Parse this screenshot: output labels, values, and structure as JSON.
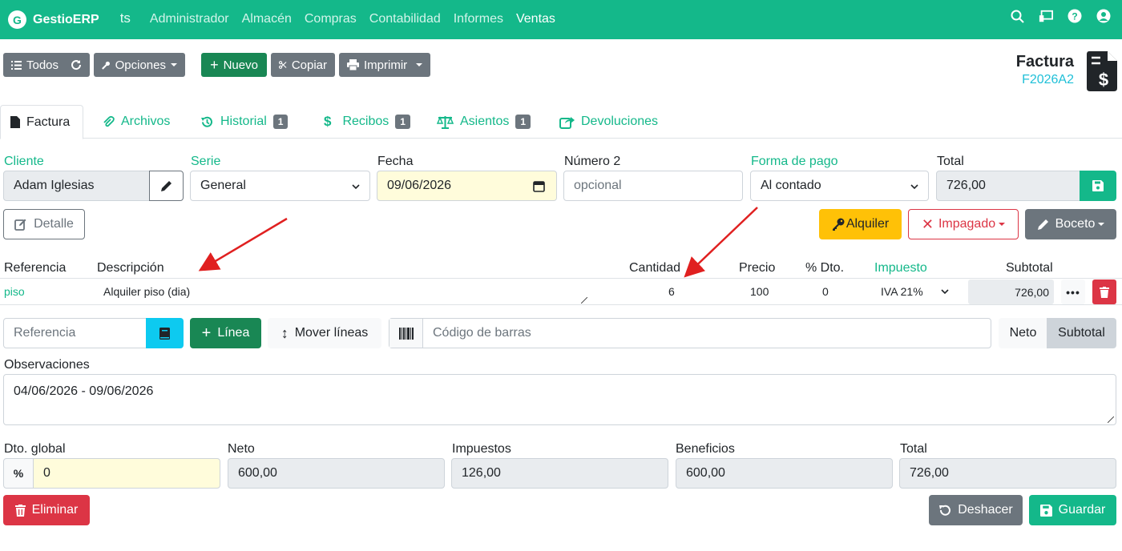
{
  "navbar": {
    "brand": "GestioERP",
    "logo_letter": "G",
    "user": "ts",
    "items": [
      "Administrador",
      "Almacén",
      "Compras",
      "Contabilidad",
      "Informes",
      "Ventas"
    ],
    "active": "Ventas",
    "icons": [
      "search-icon",
      "remote-support-icon",
      "help-icon",
      "user-icon"
    ]
  },
  "toolbar": {
    "todos": "Todos",
    "opciones": "Opciones",
    "nuevo": "Nuevo",
    "copiar": "Copiar",
    "imprimir": "Imprimir"
  },
  "doc": {
    "title": "Factura",
    "code": "F2026A2"
  },
  "tabs": [
    {
      "label": "Factura"
    },
    {
      "label": "Archivos"
    },
    {
      "label": "Historial",
      "badge": "1"
    },
    {
      "label": "Recibos",
      "badge": "1"
    },
    {
      "label": "Asientos",
      "badge": "1"
    },
    {
      "label": "Devoluciones"
    }
  ],
  "form": {
    "cliente_label": "Cliente",
    "cliente_value": "Adam Iglesias",
    "serie_label": "Serie",
    "serie_value": "General",
    "fecha_label": "Fecha",
    "fecha_value": "09/06/2026",
    "numero2_label": "Número 2",
    "numero2_placeholder": "opcional",
    "forma_pago_label": "Forma de pago",
    "forma_pago_value": "Al contado",
    "total_label": "Total",
    "total_value": "726,00"
  },
  "actions": {
    "detalle": "Detalle",
    "alquiler": "Alquiler",
    "impagado": "Impagado",
    "boceto": "Boceto"
  },
  "lines": {
    "headers": {
      "referencia": "Referencia",
      "descripcion": "Descripción",
      "cantidad": "Cantidad",
      "precio": "Precio",
      "dto": "% Dto.",
      "impuesto": "Impuesto",
      "subtotal": "Subtotal"
    },
    "rows": [
      {
        "referencia": "piso",
        "descripcion": "Alquiler piso (dia)",
        "cantidad": "6",
        "precio": "100",
        "dto": "0",
        "impuesto": "IVA 21%",
        "subtotal": "726,00"
      }
    ]
  },
  "add_line": {
    "ref_placeholder": "Referencia",
    "linea": "Línea",
    "mover": "Mover líneas",
    "barcode_placeholder": "Código de barras",
    "neto": "Neto",
    "subtotal": "Subtotal"
  },
  "observaciones": {
    "label": "Observaciones",
    "value": "04/06/2026 - 09/06/2026"
  },
  "totals": {
    "dto_label": "Dto. global",
    "dto_value": "0",
    "neto_label": "Neto",
    "neto_value": "600,00",
    "impuestos_label": "Impuestos",
    "impuestos_value": "126,00",
    "beneficios_label": "Beneficios",
    "beneficios_value": "600,00",
    "total_label": "Total",
    "total_value": "726,00"
  },
  "footer": {
    "eliminar": "Eliminar",
    "deshacer": "Deshacer",
    "guardar": "Guardar"
  },
  "colors": {
    "primary": "#14b88a",
    "success": "#198754",
    "secondary": "#6c757d",
    "danger": "#dc3545",
    "warning": "#ffc107",
    "info": "#0dcaf0",
    "annotation_arrow": "#e02020"
  }
}
